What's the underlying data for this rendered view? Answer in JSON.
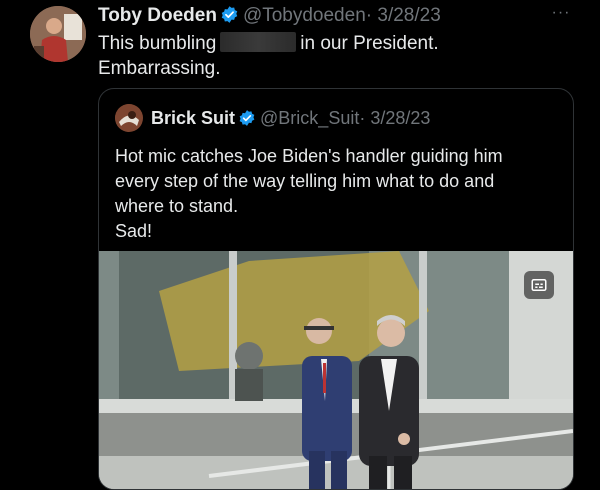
{
  "tweet": {
    "author_name": "Toby Doeden",
    "handle": "@Tobydoeden",
    "date": "· 3/28/23",
    "text_before": "This bumbling",
    "text_after": "in our President.",
    "text_line2": "Embarrassing.",
    "more_label": "···"
  },
  "quoted": {
    "author_name": "Brick Suit",
    "handle": "@Brick_Suit",
    "date": "· 3/28/23",
    "text_line1": "Hot mic catches Joe Biden's handler guiding him",
    "text_line2": "every step of the way telling him what to do and",
    "text_line3": "where to stand.",
    "text_line4": "Sad!"
  },
  "icons": {
    "verified": "verified-badge-icon",
    "more": "more-options-icon",
    "media": "media-caption-icon"
  },
  "colors": {
    "background": "#000000",
    "text": "#e7e9ea",
    "muted": "#71767b",
    "verified": "#1d9bf0",
    "border": "#2f3336"
  }
}
